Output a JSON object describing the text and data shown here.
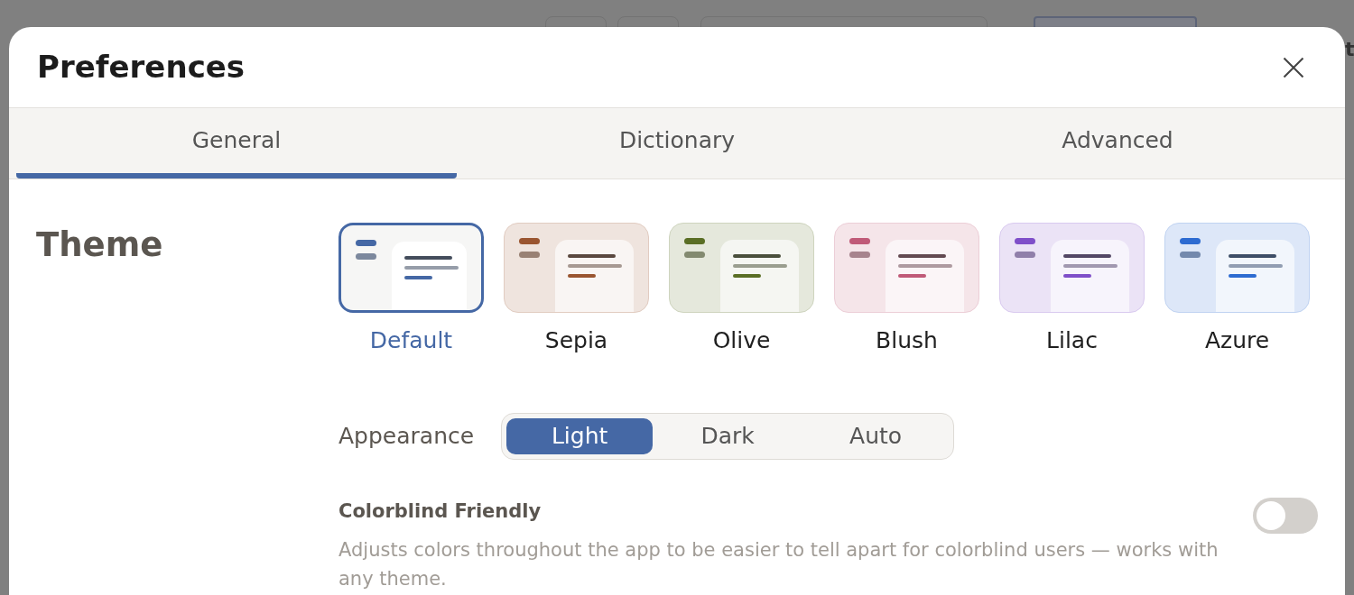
{
  "background": {
    "text_fragment": "t"
  },
  "dialog": {
    "title": "Preferences"
  },
  "tabs": [
    {
      "label": "General",
      "selected": true
    },
    {
      "label": "Dictionary",
      "selected": false
    },
    {
      "label": "Advanced",
      "selected": false
    }
  ],
  "theme": {
    "label": "Theme",
    "options": [
      {
        "name": "Default",
        "color": "#4568a5",
        "selected": true
      },
      {
        "name": "Sepia",
        "color": "#9a5530",
        "selected": false
      },
      {
        "name": "Olive",
        "color": "#5a6e25",
        "selected": false
      },
      {
        "name": "Blush",
        "color": "#c05a78",
        "selected": false
      },
      {
        "name": "Lilac",
        "color": "#7f4fc9",
        "selected": false
      },
      {
        "name": "Azure",
        "color": "#2d6bd1",
        "selected": false
      }
    ]
  },
  "appearance": {
    "label": "Appearance",
    "options": [
      {
        "label": "Light",
        "selected": true
      },
      {
        "label": "Dark",
        "selected": false
      },
      {
        "label": "Auto",
        "selected": false
      }
    ]
  },
  "colorblind": {
    "label": "Colorblind Friendly",
    "description": "Adjusts colors throughout the app to be easier to tell apart for colorblind users — works with any theme.",
    "on": false
  }
}
